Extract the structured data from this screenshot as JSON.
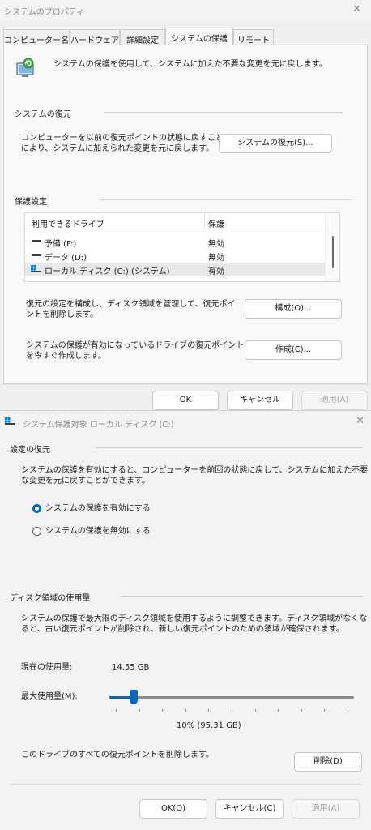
{
  "dialog1": {
    "title": "システムのプロパティ",
    "close": "✕",
    "tabs": [
      {
        "label": "コンピューター名"
      },
      {
        "label": "ハードウェア"
      },
      {
        "label": "詳細設定"
      },
      {
        "label": "システムの保護"
      },
      {
        "label": "リモート"
      }
    ],
    "active_tab": "システムの保護",
    "intro": "システムの保護を使用して、システムに加えた不要な変更を元に戻します。",
    "restore_group": {
      "label": "システムの復元",
      "desc_line1": "コンピューターを以前の復元ポイントの状態に戻すこと",
      "desc_line2": "により、システムに加えられた変更を元に戻します。",
      "button": "システムの復元(S)..."
    },
    "protection_group": {
      "label": "保護設定",
      "col_drive": "利用できるドライブ",
      "col_status": "保護",
      "drives": [
        {
          "name": "予備 (F:)",
          "status": "無効",
          "icon": "drive-icon"
        },
        {
          "name": "データ (D:)",
          "status": "無効",
          "icon": "drive-icon"
        },
        {
          "name": "ローカル ディスク (C:) (システム)",
          "status": "有効",
          "icon": "windows-drive-icon"
        }
      ]
    },
    "configure": {
      "desc_line1": "復元の設定を構成し、ディスク領域を管理して、復元ポイ",
      "desc_line2": "ントを削除します。",
      "button": "構成(O)..."
    },
    "create": {
      "desc_line1": "システムの保護が有効になっているドライブの復元ポイント",
      "desc_line2": "を今すぐ作成します。",
      "button": "作成(C)..."
    },
    "footer": {
      "ok": "OK",
      "cancel": "キャンセル",
      "apply": "適用(A)"
    }
  },
  "dialog2": {
    "title": "システム保護対象 ローカル ディスク (C:)",
    "close": "✕",
    "restore_settings": {
      "label": "設定の復元",
      "desc_line1": "システムの保護を有効にすると、コンピューターを前回の状態に戻して、システムに加えた不要",
      "desc_line2": "な変更を元に戻すことができます。",
      "option_on": "システムの保護を有効にする",
      "option_off": "システムの保護を無効にする",
      "selected": "on"
    },
    "disk_usage": {
      "label": "ディスク領域の使用量",
      "desc_line1": "システムの保護で最大限のディスク領域を使用するように調整できます。ディスク領域がなくな",
      "desc_line2": "ると、古い復元ポイントが削除され、新しい復元ポイントのための領域が確保されます。",
      "current_label": "現在の使用量:",
      "current_value": "14.55 GB",
      "max_label": "最大使用量(M):",
      "max_fraction": 0.1,
      "max_value_text": "10% (95.31 GB)",
      "delete_desc": "このドライブのすべての復元ポイントを削除します。",
      "delete_button": "削除(D)"
    },
    "footer": {
      "ok": "OK(O)",
      "cancel": "キャンセル(C)",
      "apply": "適用(A)"
    }
  },
  "colors": {
    "accent": "#0067c0",
    "window_bg": "#f3f3f3",
    "panel_bg": "#f9f9f9"
  }
}
